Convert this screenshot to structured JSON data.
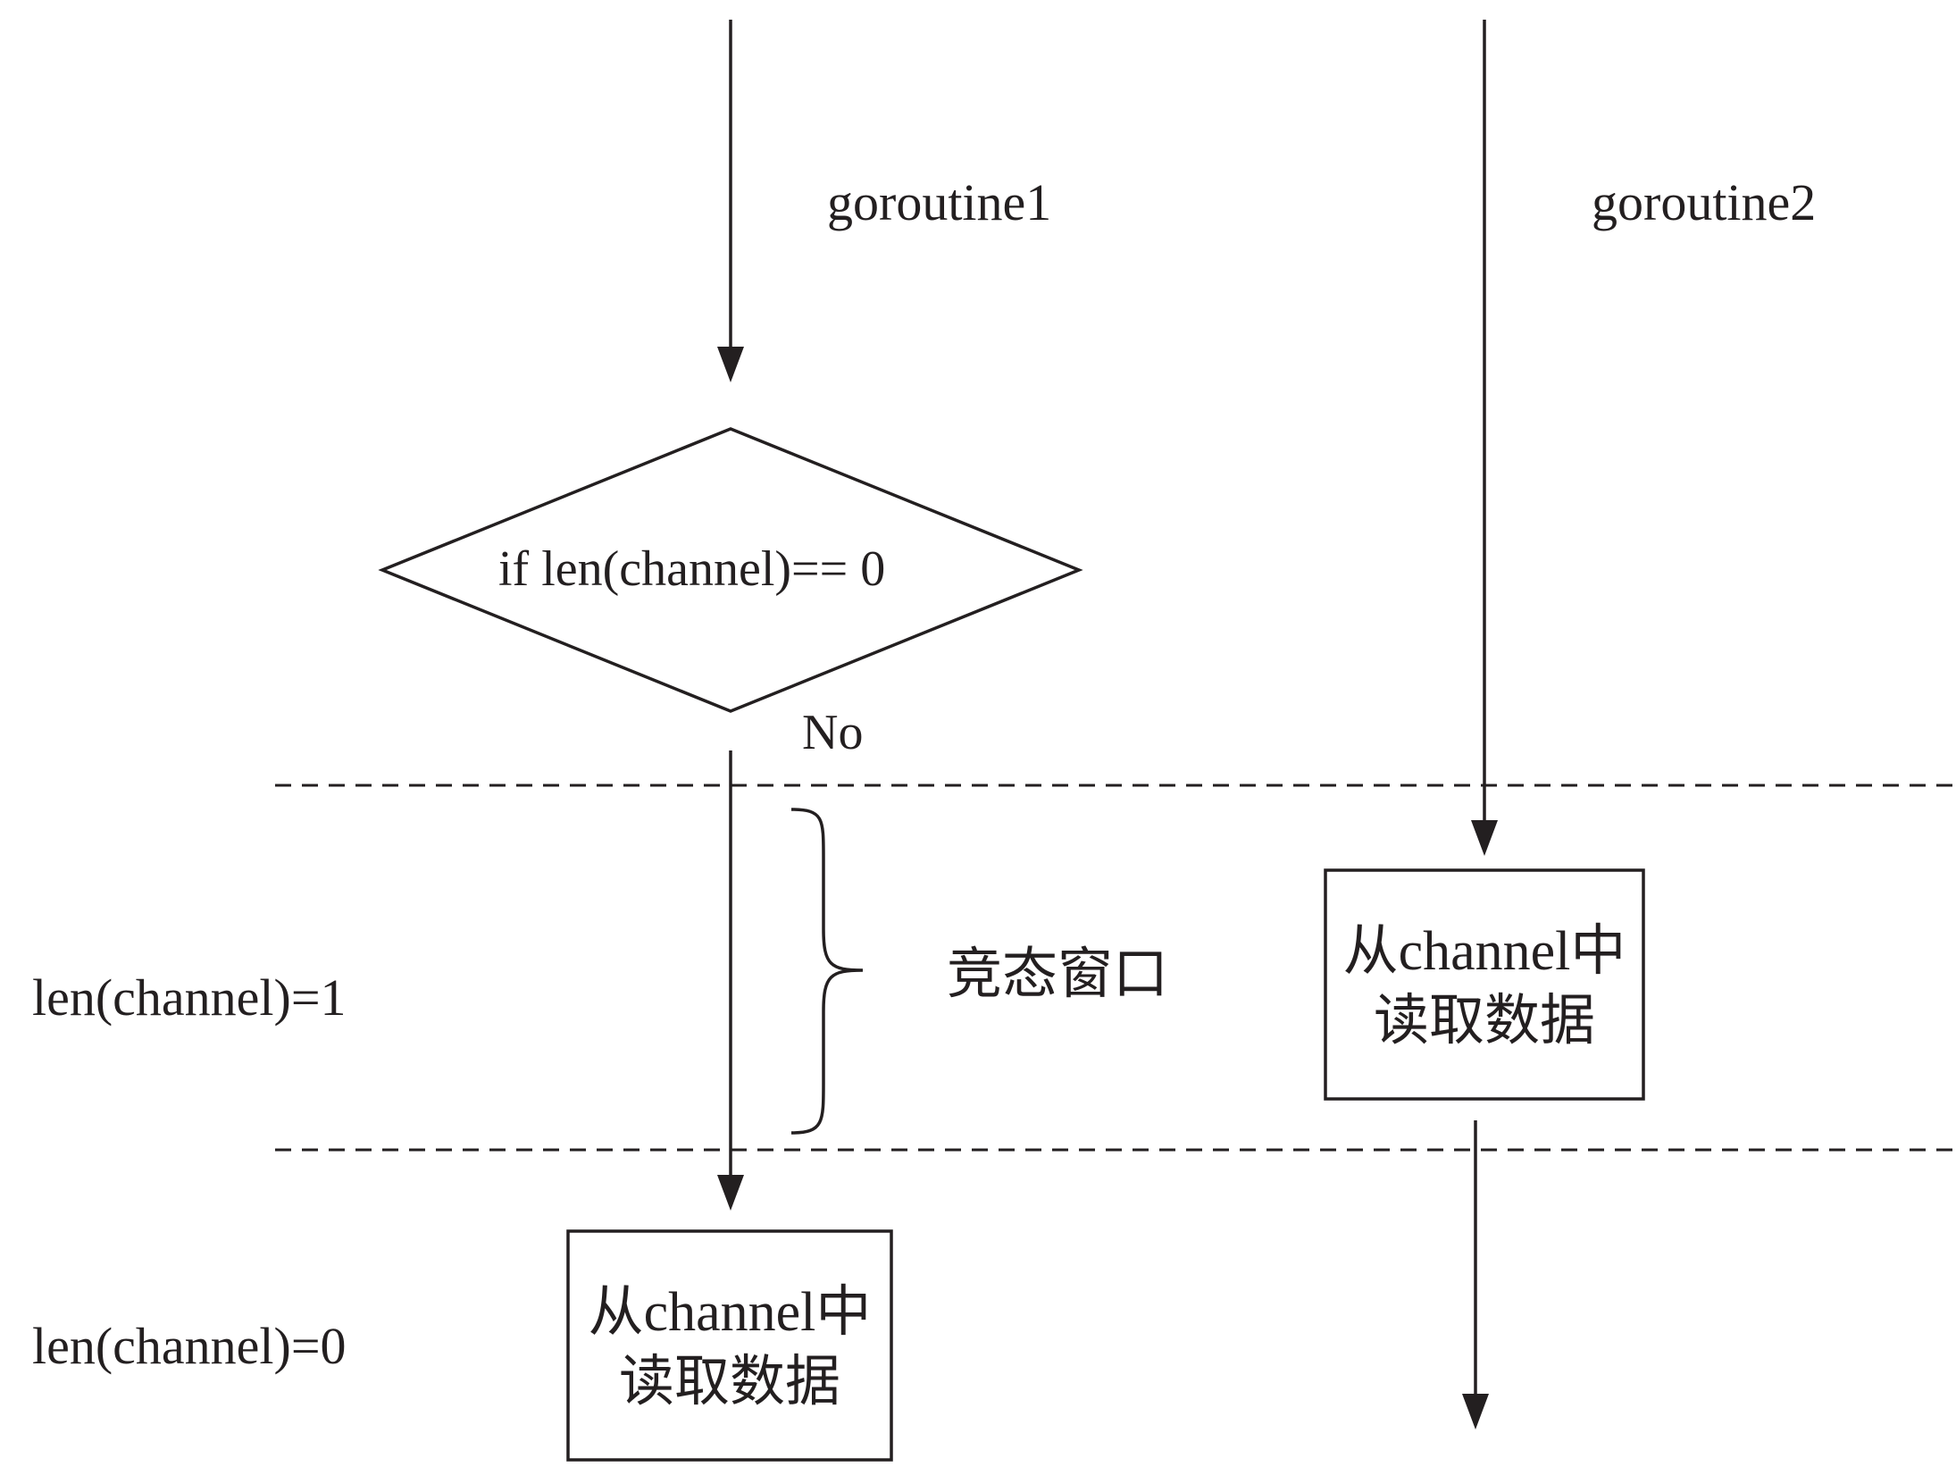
{
  "lanes": {
    "goroutine1": "goroutine1",
    "goroutine2": "goroutine2"
  },
  "decision": {
    "condition": "if len(channel)== 0",
    "branch_label": "No"
  },
  "race_window_label": "竞态窗口",
  "level_labels": {
    "len_one": "len(channel)=1",
    "len_zero": "len(channel)=0"
  },
  "read_box_g1": {
    "line1": "从channel中",
    "line2": "读取数据"
  },
  "read_box_g2": {
    "line1": "从channel中",
    "line2": "读取数据"
  },
  "colors": {
    "stroke": "#231f20",
    "background": "#ffffff"
  }
}
